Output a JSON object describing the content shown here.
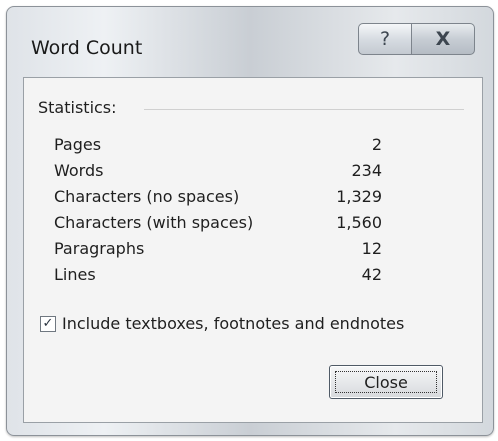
{
  "dialog": {
    "title": "Word Count",
    "help_glyph": "?",
    "close_glyph": "X"
  },
  "statistics": {
    "heading": "Statistics:",
    "rows": [
      {
        "label": "Pages",
        "value": "2"
      },
      {
        "label": "Words",
        "value": "234"
      },
      {
        "label": "Characters (no spaces)",
        "value": "1,329"
      },
      {
        "label": "Characters (with spaces)",
        "value": "1,560"
      },
      {
        "label": "Paragraphs",
        "value": "12"
      },
      {
        "label": "Lines",
        "value": "42"
      }
    ]
  },
  "options": {
    "include_label": "Include textboxes, footnotes and endnotes",
    "include_checked": true,
    "check_glyph": "✓"
  },
  "buttons": {
    "close_label": "Close"
  }
}
